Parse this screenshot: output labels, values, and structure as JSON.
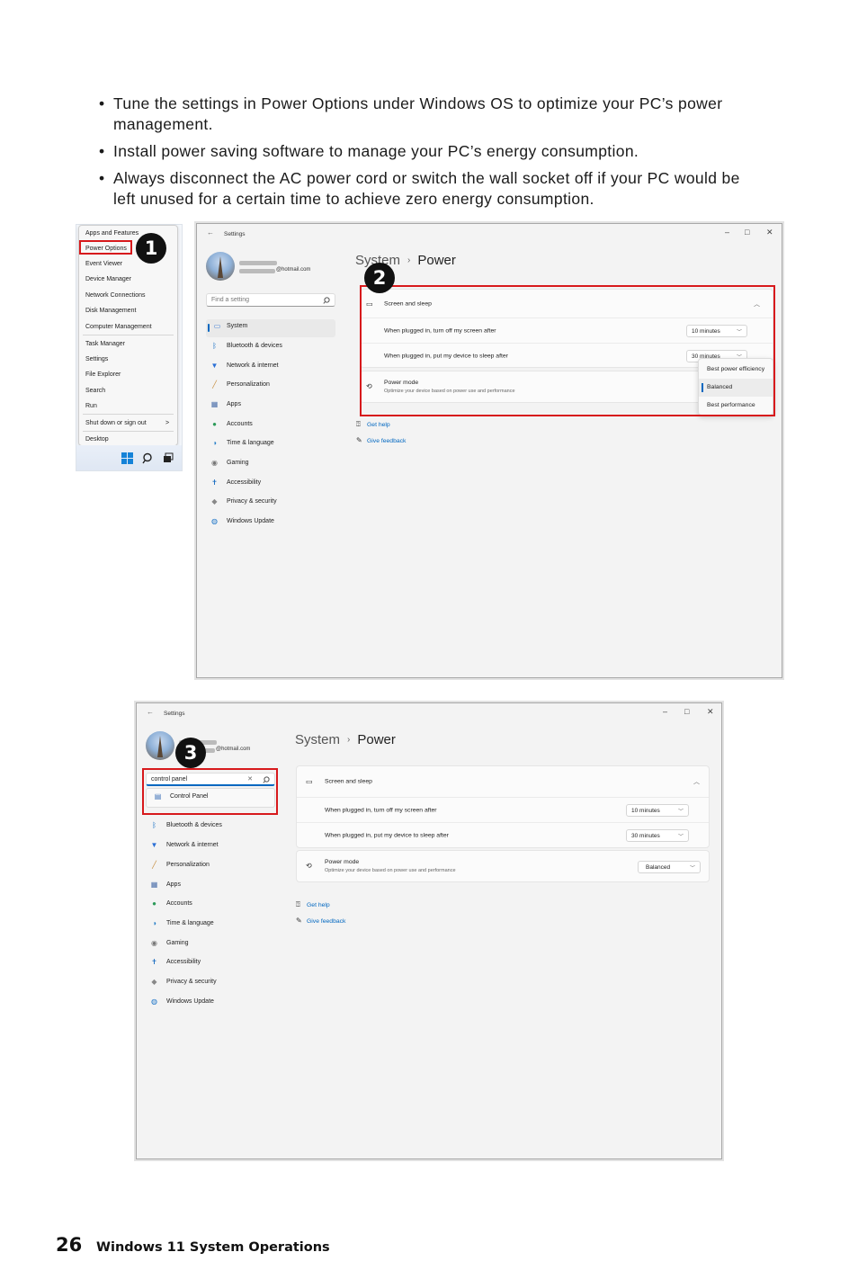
{
  "bullets": [
    "Tune the settings in Power Options under Windows OS to optimize your PC’s power management.",
    "Install power saving software to manage your PC’s energy consumption.",
    "Always disconnect the AC power cord or switch the wall socket off if your PC would be left unused for a certain time to achieve zero energy consumption."
  ],
  "winx_menu": {
    "items": [
      "Apps and Features",
      "Power Options",
      "Event Viewer",
      "Device Manager",
      "Network Connections",
      "Disk Management",
      "Computer Management",
      "Task Manager",
      "Settings",
      "File Explorer",
      "Search",
      "Run",
      "Shut down or sign out",
      "Desktop"
    ],
    "shutdown_arrow": ">"
  },
  "badges": [
    "1",
    "2",
    "3"
  ],
  "settings": {
    "title": "Settings",
    "email": "@hotmail.com",
    "search_placeholder": "Find a setting",
    "search_value": "control panel",
    "search_result": "Control Panel",
    "nav": [
      "System",
      "Bluetooth & devices",
      "Network & internet",
      "Personalization",
      "Apps",
      "Accounts",
      "Time & language",
      "Gaming",
      "Accessibility",
      "Privacy & security",
      "Windows Update"
    ],
    "breadcrumb_parent": "System",
    "breadcrumb_sep": "›",
    "breadcrumb_current": "Power",
    "screen_sleep_label": "Screen and sleep",
    "screen_off_label": "When plugged in, turn off my screen after",
    "screen_off_value": "10 minutes",
    "sleep_label": "When plugged in, put my device to sleep after",
    "sleep_value": "30 minutes",
    "power_mode_label": "Power mode",
    "power_mode_desc": "Optimize your device based on power use and performance",
    "power_mode_value": "Balanced",
    "power_mode_options": [
      "Best power efficiency",
      "Balanced",
      "Best performance"
    ],
    "get_help": "Get help",
    "give_feedback": "Give feedback",
    "window_controls": [
      "–",
      "□",
      "✕"
    ],
    "back_glyph": "←"
  },
  "footer": {
    "page_number": "26",
    "section_title": "Windows 11 System Operations"
  },
  "colors": {
    "highlight": "#d7191c",
    "accent": "#0067c0",
    "badge": "#111111"
  }
}
